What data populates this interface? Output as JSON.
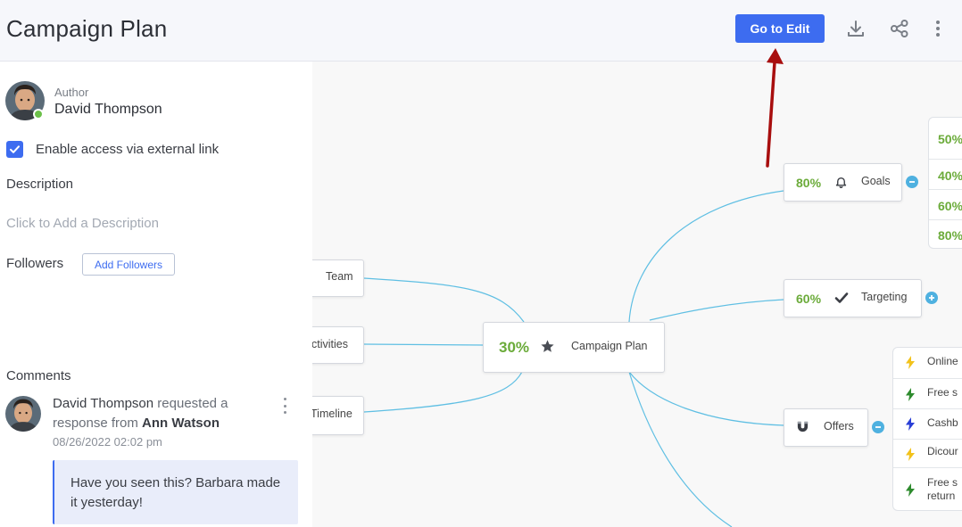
{
  "header": {
    "title": "Campaign Plan",
    "edit_button": "Go to Edit",
    "icons": [
      "download-icon",
      "share-icon",
      "more-vertical-icon"
    ]
  },
  "sidebar": {
    "author_label": "Author",
    "author_name": "David Thompson",
    "external_link_label": "Enable access via external link",
    "external_link_checked": true,
    "description_heading": "Description",
    "description_placeholder": "Click to Add a Description",
    "followers_heading": "Followers",
    "add_followers_button": "Add Followers",
    "comments_heading": "Comments",
    "comment": {
      "author": "David Thompson",
      "action": "requested a",
      "line2_prefix": "response from",
      "target": "Ann Watson",
      "date": "08/26/2022 02:02 pm",
      "text": "Have you seen this? Barbara made it yesterday!"
    }
  },
  "mindmap": {
    "center": {
      "percent": "30%",
      "label": "Campaign Plan",
      "icon": "star-icon"
    },
    "left_nodes": [
      {
        "label": "Team"
      },
      {
        "label": "ctivities"
      },
      {
        "label": "Timeline"
      }
    ],
    "right_nodes": [
      {
        "percent": "80%",
        "label": "Goals",
        "icon": "bell-icon",
        "toggle": "collapse"
      },
      {
        "percent": "60%",
        "label": "Targeting",
        "icon": "checkmark-icon",
        "toggle": "expand"
      },
      {
        "percent": "",
        "label": "Offers",
        "icon": "magnet-icon",
        "toggle": "collapse"
      }
    ],
    "goals_children": [
      "50%",
      "40%",
      "60%",
      "80%"
    ],
    "offers_children": [
      {
        "label": "Online",
        "bolt_color": "#f2c21b"
      },
      {
        "label": "Free s",
        "bolt_color": "#2e8b2e"
      },
      {
        "label": "Cashb",
        "bolt_color": "#2a3fd6"
      },
      {
        "label": "Dicour",
        "bolt_color": "#f2c21b"
      },
      {
        "label": "Free s\nreturn",
        "bolt_color": "#2e8b2e"
      }
    ]
  },
  "colors": {
    "accent": "#3d6cf0",
    "percent": "#6bab3a",
    "link": "#5fbfe3",
    "online": "#6cc04a",
    "arrow": "#a80e0e"
  }
}
